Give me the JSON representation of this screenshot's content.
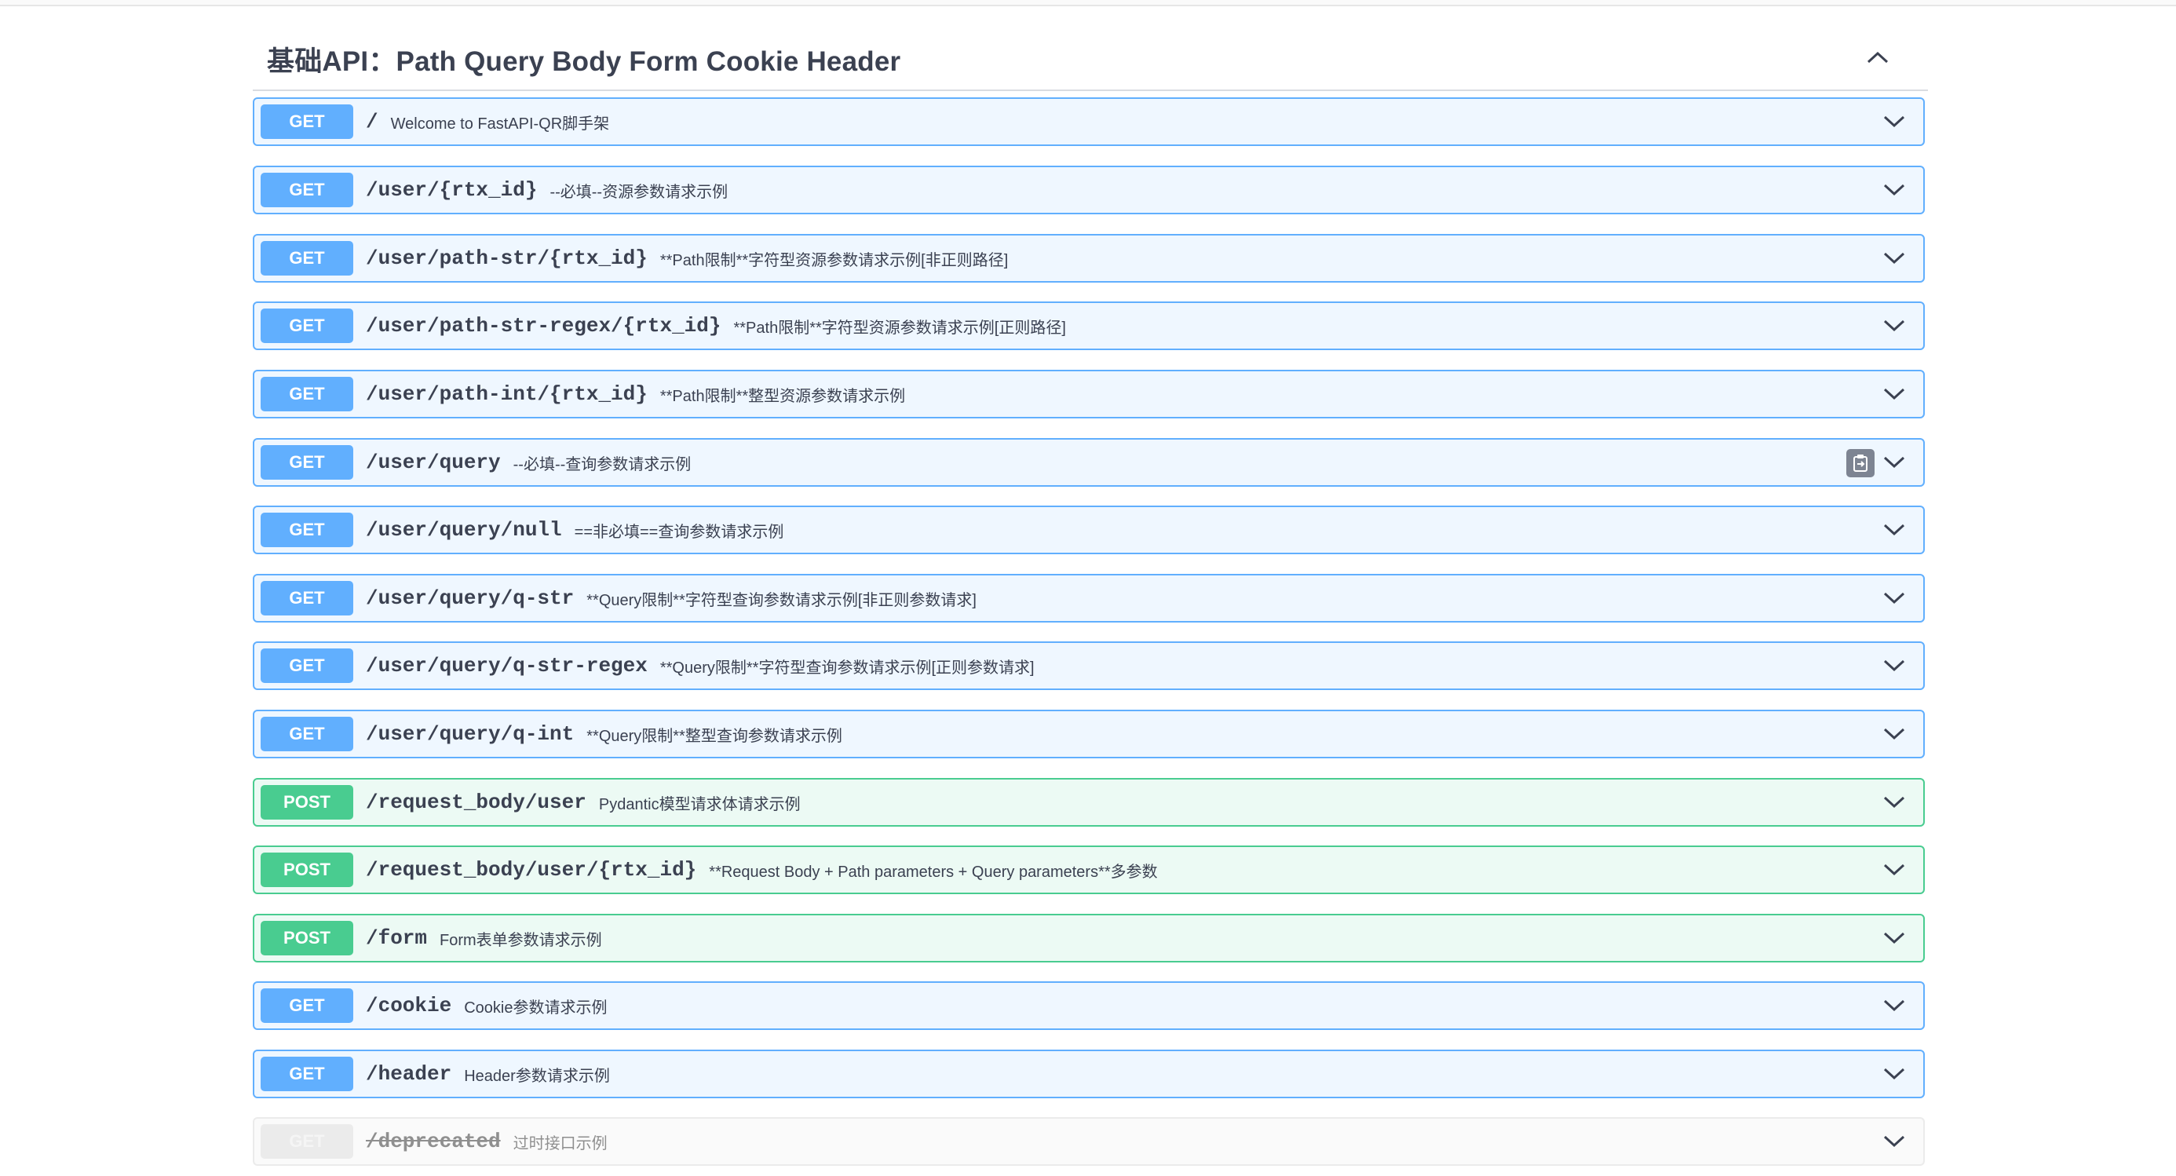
{
  "tag": {
    "title": "基础API：Path Query Body Form Cookie Header"
  },
  "icons": {
    "collapse": "chevron-up-icon",
    "expand": "chevron-down-icon",
    "copy": "copy-to-clipboard-icon"
  },
  "colors": {
    "get": "#61affe",
    "post": "#49cc90",
    "deprecated": "#ebebeb"
  },
  "operations": [
    {
      "method": "GET",
      "path": "/",
      "summary": "Welcome to FastAPI-QR脚手架",
      "kind": "get"
    },
    {
      "method": "GET",
      "path": "/user/{rtx_id}",
      "summary": "--必填--资源参数请求示例",
      "kind": "get"
    },
    {
      "method": "GET",
      "path": "/user/path-str/{rtx_id}",
      "summary": "**Path限制**字符型资源参数请求示例[非正则路径]",
      "kind": "get"
    },
    {
      "method": "GET",
      "path": "/user/path-str-regex/{rtx_id}",
      "summary": "**Path限制**字符型资源参数请求示例[正则路径]",
      "kind": "get"
    },
    {
      "method": "GET",
      "path": "/user/path-int/{rtx_id}",
      "summary": "**Path限制**整型资源参数请求示例",
      "kind": "get"
    },
    {
      "method": "GET",
      "path": "/user/query",
      "summary": "--必填--查询参数请求示例",
      "kind": "get"
    },
    {
      "method": "GET",
      "path": "/user/query/null",
      "summary": "==非必填==查询参数请求示例",
      "kind": "get"
    },
    {
      "method": "GET",
      "path": "/user/query/q-str",
      "summary": "**Query限制**字符型查询参数请求示例[非正则参数请求]",
      "kind": "get"
    },
    {
      "method": "GET",
      "path": "/user/query/q-str-regex",
      "summary": "**Query限制**字符型查询参数请求示例[正则参数请求]",
      "kind": "get"
    },
    {
      "method": "GET",
      "path": "/user/query/q-int",
      "summary": "**Query限制**整型查询参数请求示例",
      "kind": "get"
    },
    {
      "method": "POST",
      "path": "/request_body/user",
      "summary": "Pydantic模型请求体请求示例",
      "kind": "post"
    },
    {
      "method": "POST",
      "path": "/request_body/user/{rtx_id}",
      "summary": "**Request Body + Path parameters + Query parameters**多参数",
      "kind": "post"
    },
    {
      "method": "POST",
      "path": "/form",
      "summary": "Form表单参数请求示例",
      "kind": "post"
    },
    {
      "method": "GET",
      "path": "/cookie",
      "summary": "Cookie参数请求示例",
      "kind": "get"
    },
    {
      "method": "GET",
      "path": "/header",
      "summary": "Header参数请求示例",
      "kind": "get"
    },
    {
      "method": "GET",
      "path": "/deprecated",
      "summary": "过时接口示例",
      "kind": "deprecated"
    }
  ]
}
